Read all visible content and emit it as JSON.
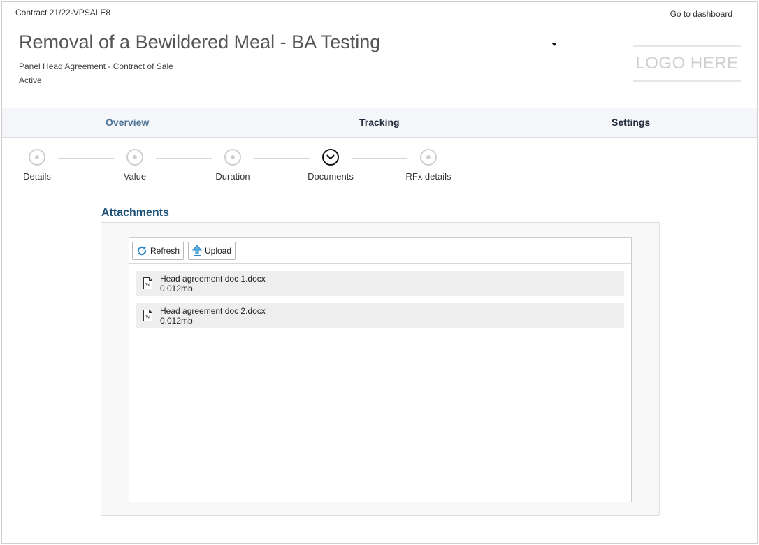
{
  "header": {
    "contract_id": "Contract 21/22-VPSALE8",
    "dashboard_link": "Go to dashboard",
    "title": "Removal of a Bewildered Meal - BA Testing",
    "subtitle": "Panel Head Agreement - Contract of Sale",
    "status": "Active",
    "logo_text": "LOGO HERE"
  },
  "tabs": [
    {
      "label": "Overview",
      "active": true
    },
    {
      "label": "Tracking",
      "active": false
    },
    {
      "label": "Settings",
      "active": false
    }
  ],
  "steps": [
    {
      "label": "Details",
      "state": "inactive"
    },
    {
      "label": "Value",
      "state": "inactive"
    },
    {
      "label": "Duration",
      "state": "inactive"
    },
    {
      "label": "Documents",
      "state": "active"
    },
    {
      "label": "RFx details",
      "state": "inactive"
    }
  ],
  "attachments": {
    "title": "Attachments",
    "refresh_label": "Refresh",
    "upload_label": "Upload",
    "files": [
      {
        "name": "Head agreement doc 1.docx",
        "size": "0.012mb",
        "icon": "word-document-icon"
      },
      {
        "name": "Head agreement doc 2.docx",
        "size": "0.012mb",
        "icon": "word-document-icon"
      }
    ]
  },
  "colors": {
    "active_tab": "#4f7395",
    "section_title": "#1c5277",
    "tab_bar_bg": "#f4f6fa",
    "file_row_bg": "#eeeeee"
  }
}
